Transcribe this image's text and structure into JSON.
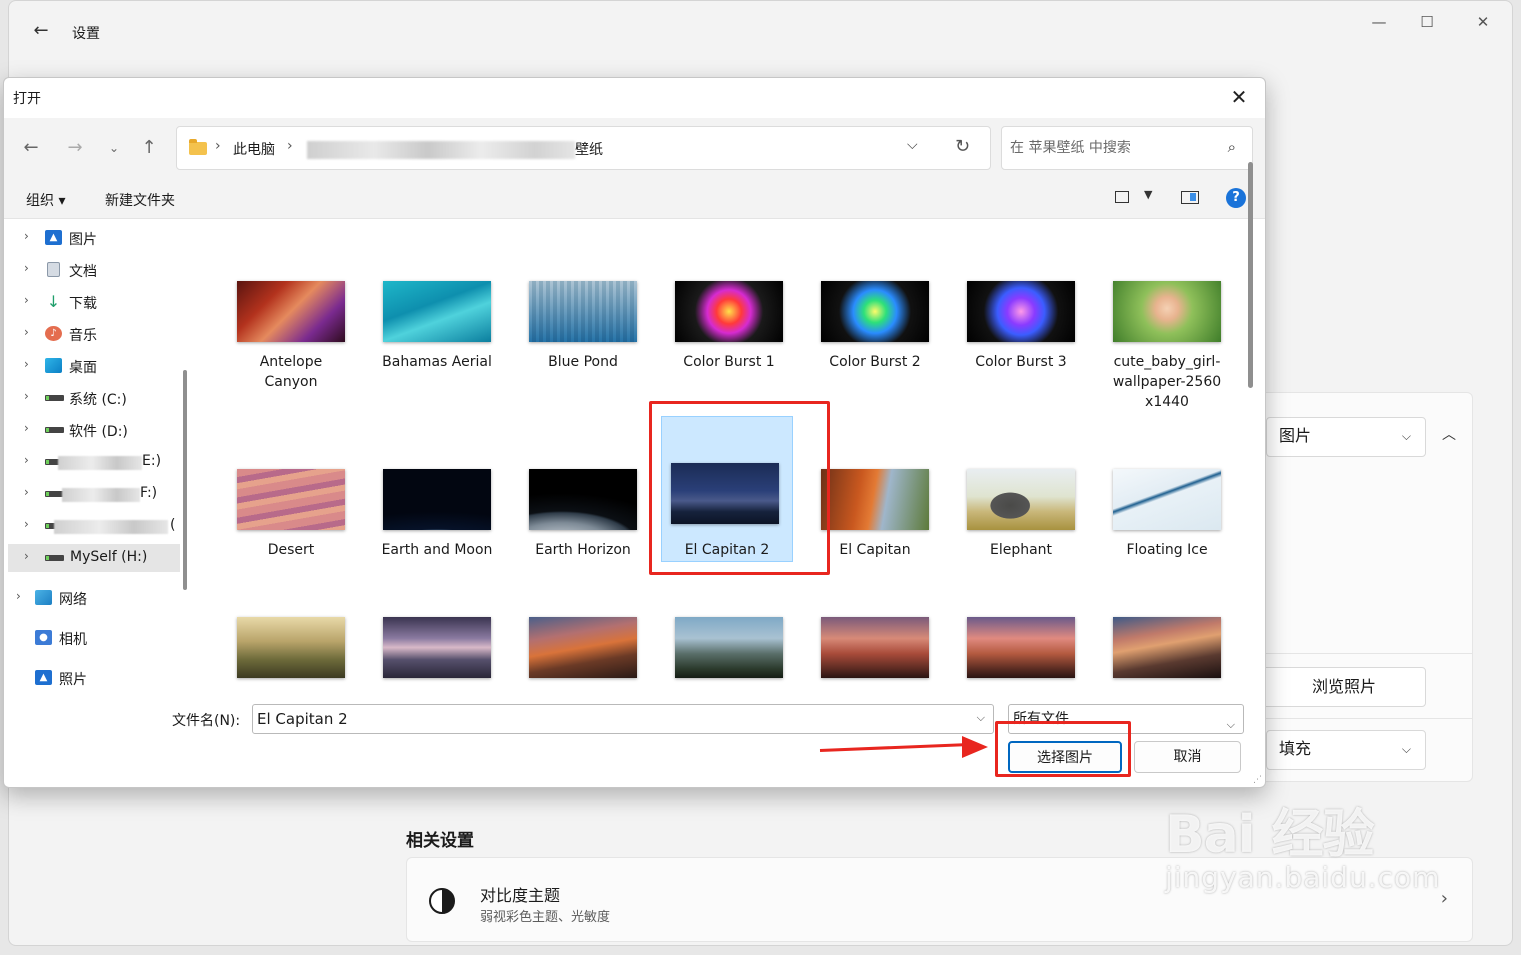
{
  "settings": {
    "title": "设置",
    "window_controls": [
      "—",
      "☐",
      "✕"
    ],
    "picture_type_dropdown": "图片",
    "browse_button": "浏览照片",
    "fit_dropdown": "填充",
    "related_heading": "相关设置",
    "contrast_title": "对比度主题",
    "contrast_subtitle": "弱视彩色主题、光敏度"
  },
  "dialog": {
    "title": "打开",
    "address": {
      "segments": [
        "此电脑",
        "壁纸"
      ]
    },
    "search_placeholder": "在 苹果壁纸 中搜索",
    "toolbar": {
      "organize": "组织 ▾",
      "new_folder": "新建文件夹",
      "help": "?"
    },
    "sidebar": {
      "items": [
        {
          "label": "图片"
        },
        {
          "label": "文档"
        },
        {
          "label": "下载"
        },
        {
          "label": "音乐"
        },
        {
          "label": "桌面"
        },
        {
          "label": "系统 (C:)"
        },
        {
          "label": "软件 (D:)"
        },
        {
          "label": "E:)"
        },
        {
          "label": "F:)"
        },
        {
          "label": "("
        },
        {
          "label": "MySelf (H:)"
        },
        {
          "label": "网络"
        },
        {
          "label": "相机"
        },
        {
          "label": "照片"
        }
      ]
    },
    "files": [
      {
        "name": "Antelope Canyon",
        "line1": "Antelope",
        "line2": "Canyon"
      },
      {
        "name": "Bahamas Aerial",
        "line1": "Bahamas Aerial"
      },
      {
        "name": "Blue Pond",
        "line1": "Blue Pond"
      },
      {
        "name": "Color Burst 1",
        "line1": "Color Burst 1"
      },
      {
        "name": "Color Burst 2",
        "line1": "Color Burst 2"
      },
      {
        "name": "Color Burst 3",
        "line1": "Color Burst 3"
      },
      {
        "name": "cute_baby_girl-wallpaper-2560x1440",
        "line1": "cute_baby_girl-",
        "line2": "wallpaper-2560",
        "line3": "x1440"
      },
      {
        "name": "Desert",
        "line1": "Desert"
      },
      {
        "name": "Earth and Moon",
        "line1": "Earth and Moon"
      },
      {
        "name": "Earth Horizon",
        "line1": "Earth Horizon"
      },
      {
        "name": "El Capitan 2",
        "line1": "El Capitan 2"
      },
      {
        "name": "El Capitan",
        "line1": "El Capitan"
      },
      {
        "name": "Elephant",
        "line1": "Elephant"
      },
      {
        "name": "Floating Ice",
        "line1": "Floating Ice"
      }
    ],
    "filename_label": "文件名(N):",
    "filename_value": "El Capitan 2",
    "filetype_value": "所有文件",
    "select_button": "选择图片",
    "cancel_button": "取消"
  },
  "watermark": {
    "main": "Bai 经验",
    "sub": "jingyan.baidu.com"
  }
}
